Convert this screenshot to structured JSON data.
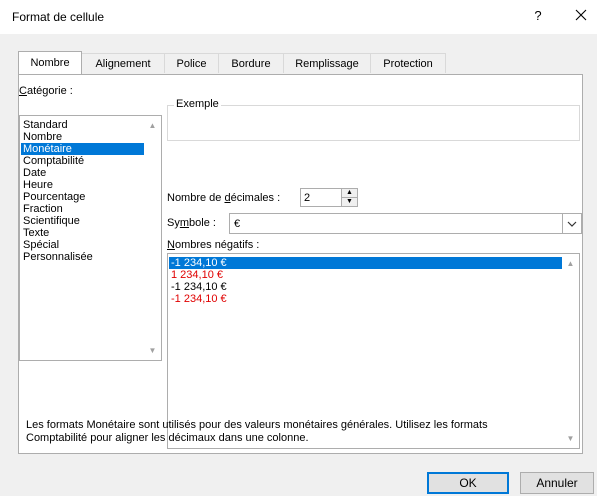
{
  "window": {
    "title": "Format de cellule",
    "help": "?",
    "close": "×"
  },
  "tabs": [
    {
      "label": "Nombre",
      "active": true
    },
    {
      "label": "Alignement"
    },
    {
      "label": "Police"
    },
    {
      "label": "Bordure"
    },
    {
      "label": "Remplissage"
    },
    {
      "label": "Protection"
    }
  ],
  "category": {
    "label_u": "C",
    "label_rest": "atégorie :",
    "items": [
      "Standard",
      "Nombre",
      "Monétaire",
      "Comptabilité",
      "Date",
      "Heure",
      "Pourcentage",
      "Fraction",
      "Scientifique",
      "Texte",
      "Spécial",
      "Personnalisée"
    ],
    "selected_index": 2
  },
  "example": {
    "label": "Exemple",
    "value": ""
  },
  "decimals": {
    "label_pre": "Nombre de ",
    "label_u": "d",
    "label_post": "écimales :",
    "value": "2"
  },
  "symbol": {
    "label_pre": "Sy",
    "label_u": "m",
    "label_post": "bole :",
    "value": "€"
  },
  "negative": {
    "label_u": "N",
    "label_rest": "ombres négatifs :",
    "items": [
      {
        "text": "-1 234,10 €",
        "color": "#000000"
      },
      {
        "text": "1 234,10 €",
        "color": "#e00000"
      },
      {
        "text": "-1 234,10 €",
        "color": "#000000"
      },
      {
        "text": "-1 234,10 €",
        "color": "#e00000"
      }
    ],
    "selected_index": 0
  },
  "description": {
    "line1": "Les formats Monétaire sont utilisés pour des valeurs monétaires générales. Utilisez les formats",
    "line2": "Comptabilité pour aligner les décimaux dans une colonne."
  },
  "buttons": {
    "ok": "OK",
    "cancel": "Annuler"
  },
  "colors": {
    "accent": "#0078d7",
    "negative_red": "#e00000"
  }
}
